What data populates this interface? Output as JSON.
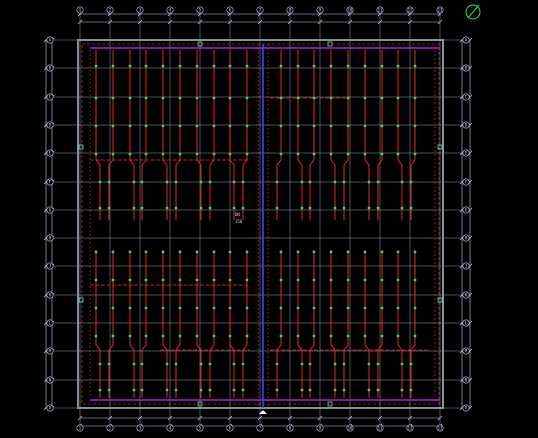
{
  "drawing": {
    "background": "#000000",
    "colors": {
      "grid": "#c8ccec",
      "dims": "#c8ccec",
      "pipe": "#ff2a2a",
      "main": "#b21cd6",
      "mainV": "#2c4cff",
      "sprinkler": "#27e64a",
      "wall": "#8a8f99",
      "annot": "#ffffff"
    },
    "icons": [
      "north-arrow-icon"
    ],
    "grid_labels_top": [
      "1",
      "2",
      "3",
      "4",
      "5",
      "6",
      "7",
      "8",
      "9",
      "10",
      "11",
      "12",
      "13"
    ],
    "grid_labels_left": [
      "A",
      "B",
      "C",
      "D",
      "E",
      "F",
      "G",
      "H",
      "J",
      "K",
      "L",
      "M",
      "N",
      "P"
    ],
    "center_notes": [
      "DN",
      "150"
    ]
  }
}
